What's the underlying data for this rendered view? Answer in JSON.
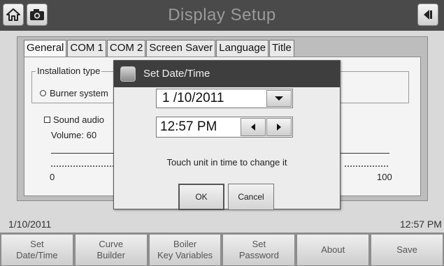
{
  "header": {
    "title": "Display Setup",
    "left_icons": [
      "home-icon",
      "camera-icon"
    ],
    "right_icon": "back-arrow-icon"
  },
  "tabs": [
    {
      "label": "General",
      "active": true
    },
    {
      "label": "COM 1",
      "active": false
    },
    {
      "label": "COM 2",
      "active": false
    },
    {
      "label": "Screen Saver",
      "active": false
    },
    {
      "label": "Language",
      "active": false
    },
    {
      "label": "Title",
      "active": false
    }
  ],
  "general": {
    "installation_type_label": "Installation type",
    "radio_label": "Burner system",
    "sound_label": "Sound audio",
    "volume_label": "Volume:  60",
    "slider_min": "0",
    "slider_max": "100",
    "volume_value": 60
  },
  "dialog": {
    "title": "Set Date/Time",
    "date_value": "1 /10/2011",
    "time_value": "12:57 PM",
    "hint": "Touch unit in time to change it",
    "ok_label": "OK",
    "cancel_label": "Cancel"
  },
  "status": {
    "date": "1/10/2011",
    "time": "12:57 PM"
  },
  "bottom_buttons": [
    "Set\nDate/Time",
    "Curve\nBuilder",
    "Boiler\nKey Variables",
    "Set\nPassword",
    "About",
    "Save"
  ],
  "colors": {
    "topbar": "#4a4a4a",
    "dialog_titlebar": "#3e3e3e",
    "title_text": "#9a9a9a"
  }
}
